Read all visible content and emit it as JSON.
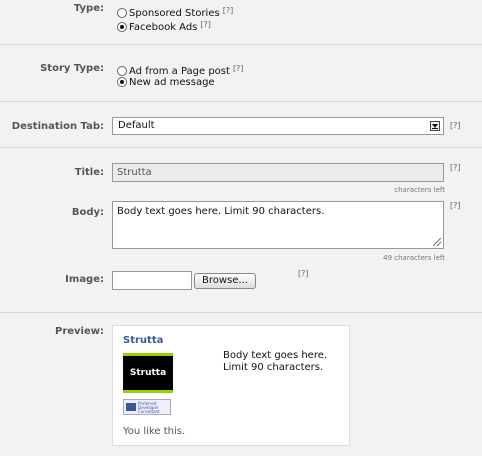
{
  "type_section": {
    "label": "Type:",
    "options": [
      {
        "label": "Sponsored Stories",
        "checked": false
      },
      {
        "label": "Facebook Ads",
        "checked": true
      }
    ],
    "help": "[?]"
  },
  "story_type_section": {
    "label": "Story Type:",
    "options": [
      {
        "label": "Ad from a Page post",
        "checked": false
      },
      {
        "label": "New ad message",
        "checked": true
      }
    ],
    "help": "[?]"
  },
  "destination_tab": {
    "label": "Destination Tab:",
    "value": "Default",
    "help": "[?]"
  },
  "title_field": {
    "label": "Title:",
    "value": "Strutta",
    "counter": "characters left",
    "help": "[?]"
  },
  "body_field": {
    "label": "Body:",
    "value": "Body text goes here. Limit 90 characters.",
    "counter": "49 characters left",
    "help": "[?]"
  },
  "image_field": {
    "label": "Image:",
    "value": "",
    "browse_label": "Browse...",
    "help": "[?]"
  },
  "preview": {
    "label": "Preview:",
    "ad_title": "Strutta",
    "logo_text": "Strutta",
    "ad_body": "Body text goes here. Limit 90 characters.",
    "badge_text": "Preferred\nDeveloper\nConsultant",
    "social_text": "You like this.",
    "title_color": "#3b5998",
    "logo_accent": "#9bd100"
  },
  "icons": [
    "radio-icon",
    "dropdown-arrow-icon",
    "resize-grip-icon",
    "facebook-badge-icon"
  ]
}
